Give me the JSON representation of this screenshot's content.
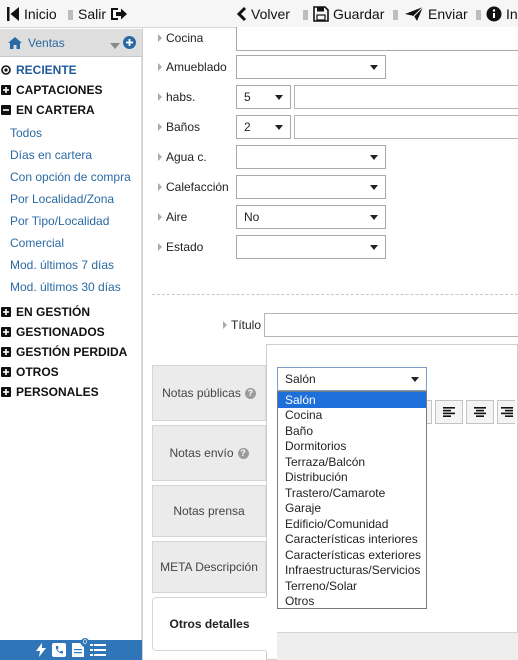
{
  "toolbar": {
    "inicio": "Inicio",
    "salir": "Salir",
    "volver": "Volver",
    "guardar": "Guardar",
    "enviar": "Enviar",
    "info": "In"
  },
  "sidebar": {
    "header": "Ventas",
    "categories": {
      "reciente": "RECIENTE",
      "captaciones": "CAPTACIONES",
      "en_cartera": "EN CARTERA",
      "en_gestion": "EN GESTIÓN",
      "gestionados": "GESTIONADOS",
      "gestion_perdida": "GESTIÓN PERDIDA",
      "otros": "OTROS",
      "personales": "PERSONALES"
    },
    "subitems": [
      "Todos",
      "Días en cartera",
      "Con opción de compra",
      "Por Localidad/Zona",
      "Por Tipo/Localidad",
      "Comercial",
      "Mod. últimos 7 días",
      "Mod. últimos 30 días"
    ],
    "footer_badge": "0"
  },
  "form": {
    "fields": {
      "cocina": {
        "label": "Cocina",
        "value": ""
      },
      "amueblado": {
        "label": "Amueblado",
        "value": ""
      },
      "habs": {
        "label": "habs.",
        "value": "5"
      },
      "banos": {
        "label": "Baños",
        "value": "2"
      },
      "agua": {
        "label": "Agua c.",
        "value": ""
      },
      "calefaccion": {
        "label": "Calefacción",
        "value": ""
      },
      "aire": {
        "label": "Aire",
        "value": "No"
      },
      "estado": {
        "label": "Estado",
        "value": ""
      }
    },
    "titulo": {
      "label": "Título",
      "value": ""
    }
  },
  "notes": {
    "tabs": [
      "Notas públicas",
      "Notas envío",
      "Notas prensa",
      "META Descripción",
      "Otros detalles"
    ],
    "active_tab": "Otros detalles"
  },
  "section_select": {
    "value": "Salón",
    "options": [
      "Salón",
      "Cocina",
      "Baño",
      "Dormitorios",
      "Terraza/Balcón",
      "Distribución",
      "Trastero/Camarote",
      "Garaje",
      "Edificio/Comunidad",
      "Características interiores",
      "Características exteriores",
      "Infraestructuras/Servicios",
      "Terreno/Solar",
      "Otros"
    ],
    "highlighted": "Salón"
  },
  "colors": {
    "link_blue": "#2a6aa3",
    "footer_blue": "#2f75b8",
    "selection_blue": "#1e6fd9"
  }
}
